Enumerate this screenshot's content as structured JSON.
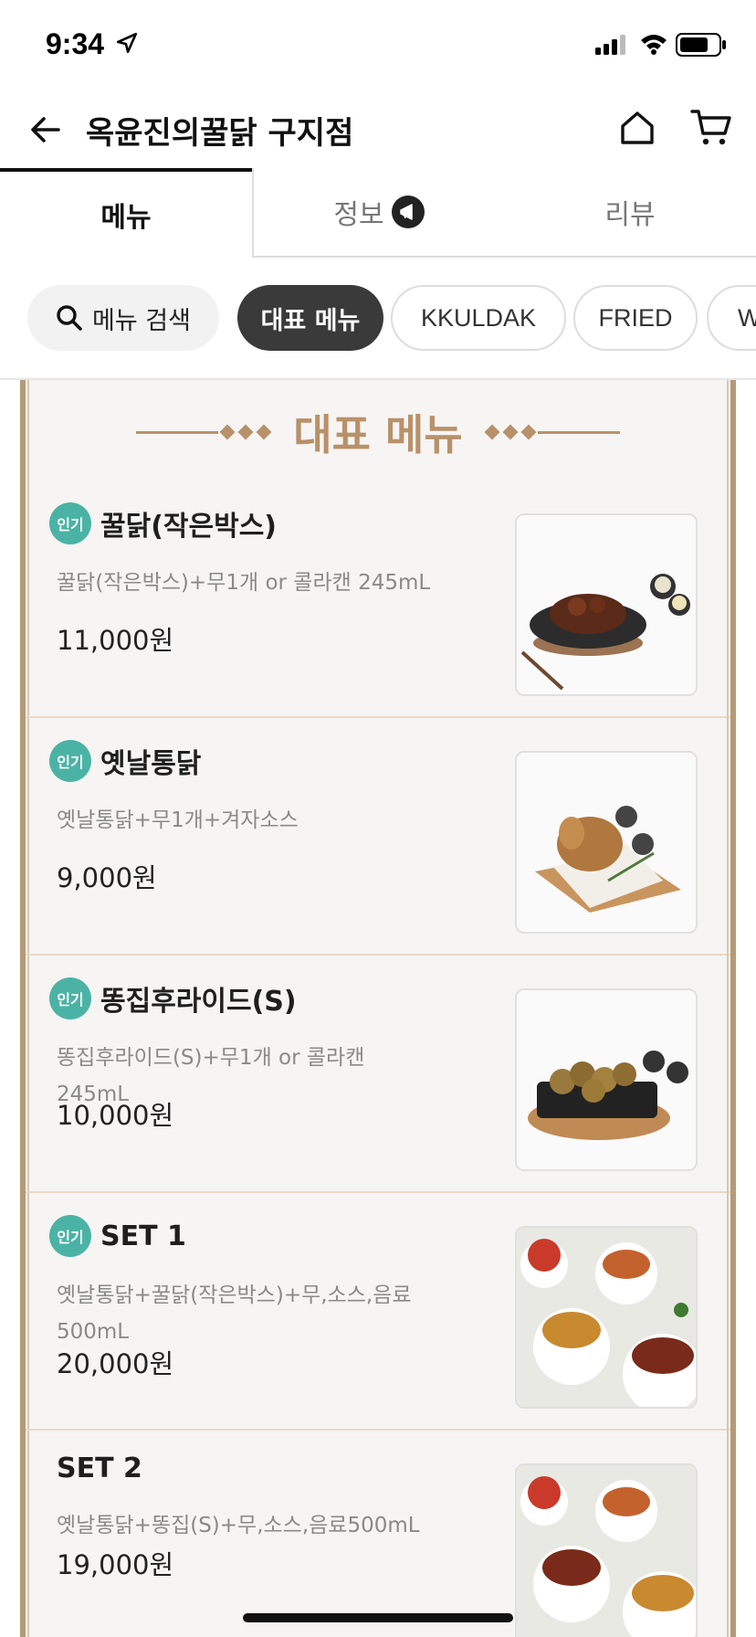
{
  "status_bar": {
    "time": "9:34"
  },
  "header": {
    "title": "옥윤진의꿀닭 구지점"
  },
  "tabs": [
    {
      "label": "메뉴"
    },
    {
      "label": "정보"
    },
    {
      "label": "리뷰"
    }
  ],
  "chips": {
    "search": "메뉴 검색",
    "items": [
      "대표 메뉴",
      "KKULDAK",
      "FRIED",
      "W"
    ]
  },
  "section": {
    "title": "대표 메뉴"
  },
  "badge_label": "인기",
  "menu_items": [
    {
      "name": "꿀닭(작은박스)",
      "desc": "꿀닭(작은박스)+무1개 or 콜라캔 245mL",
      "price": "11,000원",
      "popular": true
    },
    {
      "name": "옛날통닭",
      "desc": "옛날통닭+무1개+겨자소스",
      "price": "9,000원",
      "popular": true
    },
    {
      "name": "똥집후라이드(S)",
      "desc": "똥집후라이드(S)+무1개 or 콜라캔 245mL",
      "price": "10,000원",
      "popular": true
    },
    {
      "name": "SET 1",
      "desc": "옛날통닭+꿀닭(작은박스)+무,소스,음료500mL",
      "price": "20,000원",
      "popular": true
    },
    {
      "name": "SET 2",
      "desc": "옛날통닭+똥집(S)+무,소스,음료500mL",
      "price": "19,000원",
      "popular": false
    }
  ],
  "colors": {
    "accent_gold": "#b8916a",
    "badge_teal": "#4bb3a6",
    "chip_active": "#3a3a3a"
  }
}
